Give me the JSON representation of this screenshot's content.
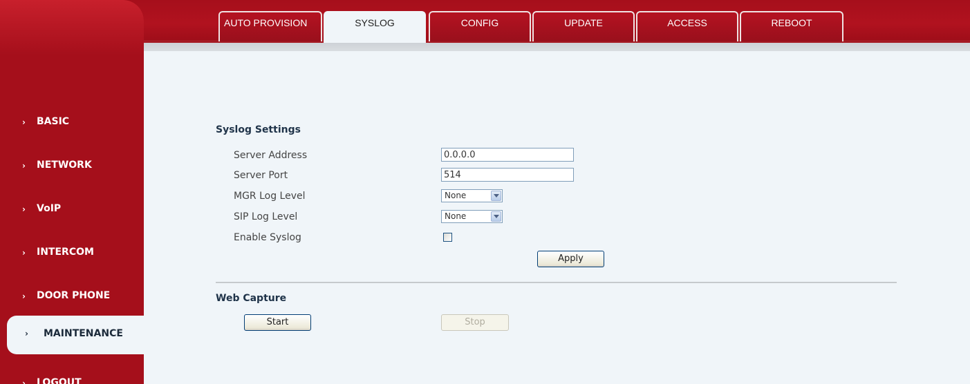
{
  "tabs": [
    {
      "label": "AUTO PROVISION",
      "active": false
    },
    {
      "label": "SYSLOG",
      "active": true
    },
    {
      "label": "CONFIG",
      "active": false
    },
    {
      "label": "UPDATE",
      "active": false
    },
    {
      "label": "ACCESS",
      "active": false
    },
    {
      "label": "REBOOT",
      "active": false
    }
  ],
  "sidebar": {
    "items": [
      {
        "label": "BASIC",
        "active": false
      },
      {
        "label": "NETWORK",
        "active": false
      },
      {
        "label": "VoIP",
        "active": false
      },
      {
        "label": "INTERCOM",
        "active": false
      },
      {
        "label": "DOOR PHONE",
        "active": false
      },
      {
        "label": "MAINTENANCE",
        "active": true
      },
      {
        "label": "LOGOUT",
        "active": false
      }
    ],
    "chevron": "›"
  },
  "syslog": {
    "title": "Syslog Settings",
    "server_address_label": "Server Address",
    "server_address_value": "0.0.0.0",
    "server_port_label": "Server Port",
    "server_port_value": "514",
    "mgr_log_level_label": "MGR Log Level",
    "mgr_log_level_value": "None",
    "sip_log_level_label": "SIP Log Level",
    "sip_log_level_value": "None",
    "enable_syslog_label": "Enable Syslog",
    "enable_syslog_checked": false,
    "apply_label": "Apply"
  },
  "web_capture": {
    "title": "Web Capture",
    "start_label": "Start",
    "stop_label": "Stop"
  },
  "colors": {
    "brand_red": "#a50f1b",
    "content_bg": "#f0f5f9"
  }
}
